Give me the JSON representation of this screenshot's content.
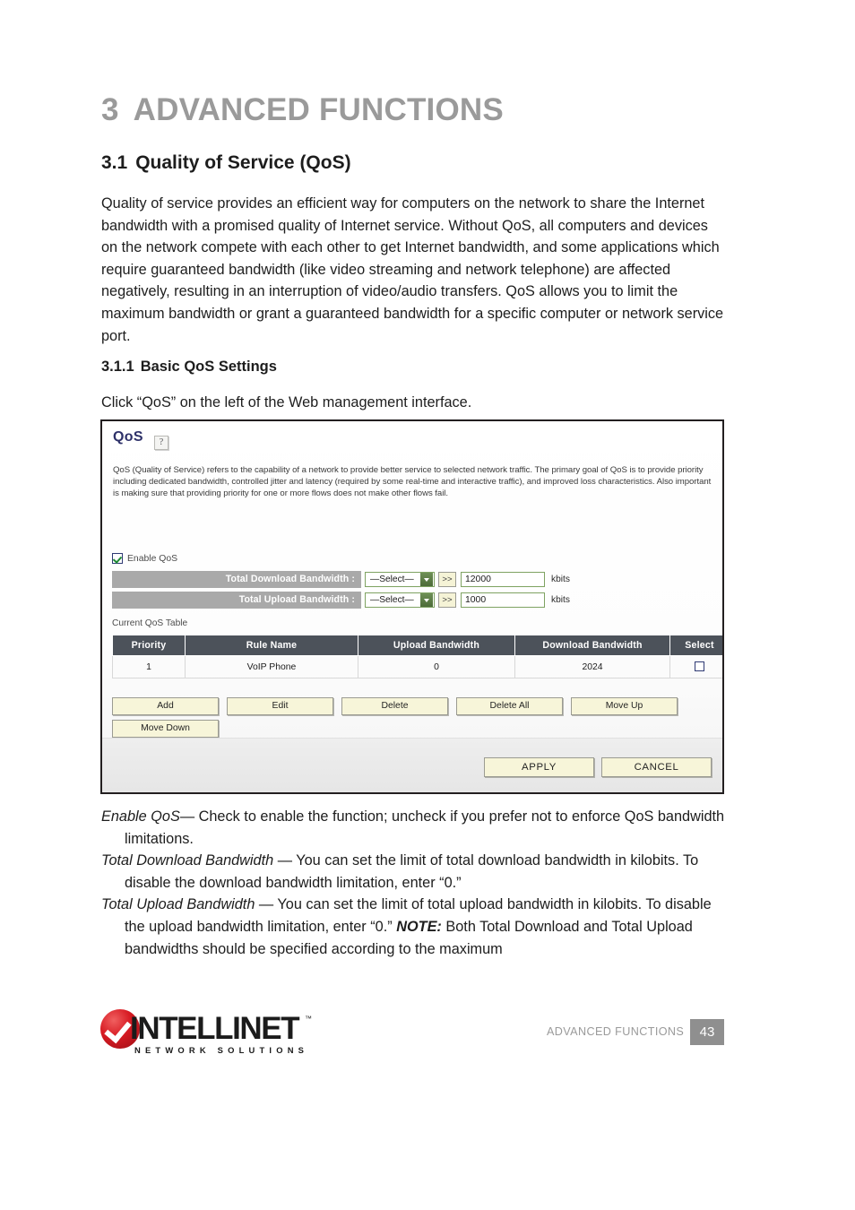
{
  "chapter": {
    "number": "3",
    "title": "ADVANCED FUNCTIONS"
  },
  "section": {
    "number": "3.1",
    "title": "Quality of Service (QoS)",
    "body": "Quality of service provides an efficient way for computers on the network to share the Internet bandwidth with a promised quality of Internet service. Without QoS, all computers and devices on the network compete with each other to get Internet bandwidth, and some applications which require guaranteed bandwidth (like video streaming and network telephone) are affected negatively, resulting in an interruption of video/audio transfers. QoS allows you to limit the maximum bandwidth or grant a guaranteed bandwidth for a specific computer or network service port."
  },
  "subsection": {
    "number": "3.1.1",
    "title": "Basic QoS Settings",
    "instruction": "Click “QoS” on the left of the Web management interface."
  },
  "ui": {
    "panel_title": "QoS",
    "help_icon_glyph": "?",
    "description": "QoS (Quality of Service) refers to the capability of a network to provide better service to selected network traffic. The primary goal of QoS is to provide priority including dedicated bandwidth, controlled jitter and latency (required by some real-time and interactive traffic), and improved loss characteristics. Also important is making sure that providing priority for one or more flows does not make other flows fail.",
    "enable_checkbox_label": "Enable QoS",
    "enable_checkbox_checked": true,
    "rows": [
      {
        "label": "Total Download Bandwidth :",
        "select_value": "—Select—",
        "go_button": ">>",
        "input_value": "12000",
        "unit": "kbits"
      },
      {
        "label": "Total Upload Bandwidth :",
        "select_value": "—Select—",
        "go_button": ">>",
        "input_value": "1000",
        "unit": "kbits"
      }
    ],
    "table": {
      "caption": "Current QoS Table",
      "columns": [
        "Priority",
        "Rule Name",
        "Upload Bandwidth",
        "Download Bandwidth",
        "Select"
      ],
      "rows": [
        {
          "priority": "1",
          "rule_name": "VoIP Phone",
          "upload_bandwidth": "0",
          "download_bandwidth": "2024",
          "selected": false
        }
      ]
    },
    "action_buttons_row1": [
      "Add",
      "Edit",
      "Delete",
      "Delete All",
      "Move Up"
    ],
    "action_buttons_row2": [
      "Move Down"
    ],
    "apply_button": "APPLY",
    "cancel_button": "CANCEL",
    "colors": {
      "panel_border": "#231f20",
      "label_bar": "#a9a9a9",
      "table_header": "#4c525a",
      "button_face": "#f7f5d9",
      "select_border": "#7fa362",
      "title_text": "#2e3169"
    }
  },
  "definitions": [
    {
      "term": "Enable QoS",
      "text": "— Check to enable the function; uncheck if you prefer not to enforce QoS bandwidth limitations."
    },
    {
      "term": "Total Download Bandwidth",
      "text": " — You can set the limit of total download bandwidth in kilobits. To disable the download bandwidth limitation, enter “0.”"
    },
    {
      "term": "Total Upload Bandwidth",
      "text": " — You can set the limit of total upload bandwidth in kilobits. To disable the upload bandwidth limitation, enter “0.” ",
      "note_label": "NOTE:",
      "note_text": " Both Total Download and Total Upload bandwidths should be specified according to the maximum"
    }
  ],
  "footer": {
    "brand": "INTELLINET",
    "trademark": "™",
    "tagline": "NETWORK SOLUTIONS",
    "caption": "ADVANCED FUNCTIONS",
    "page_number": "43"
  }
}
